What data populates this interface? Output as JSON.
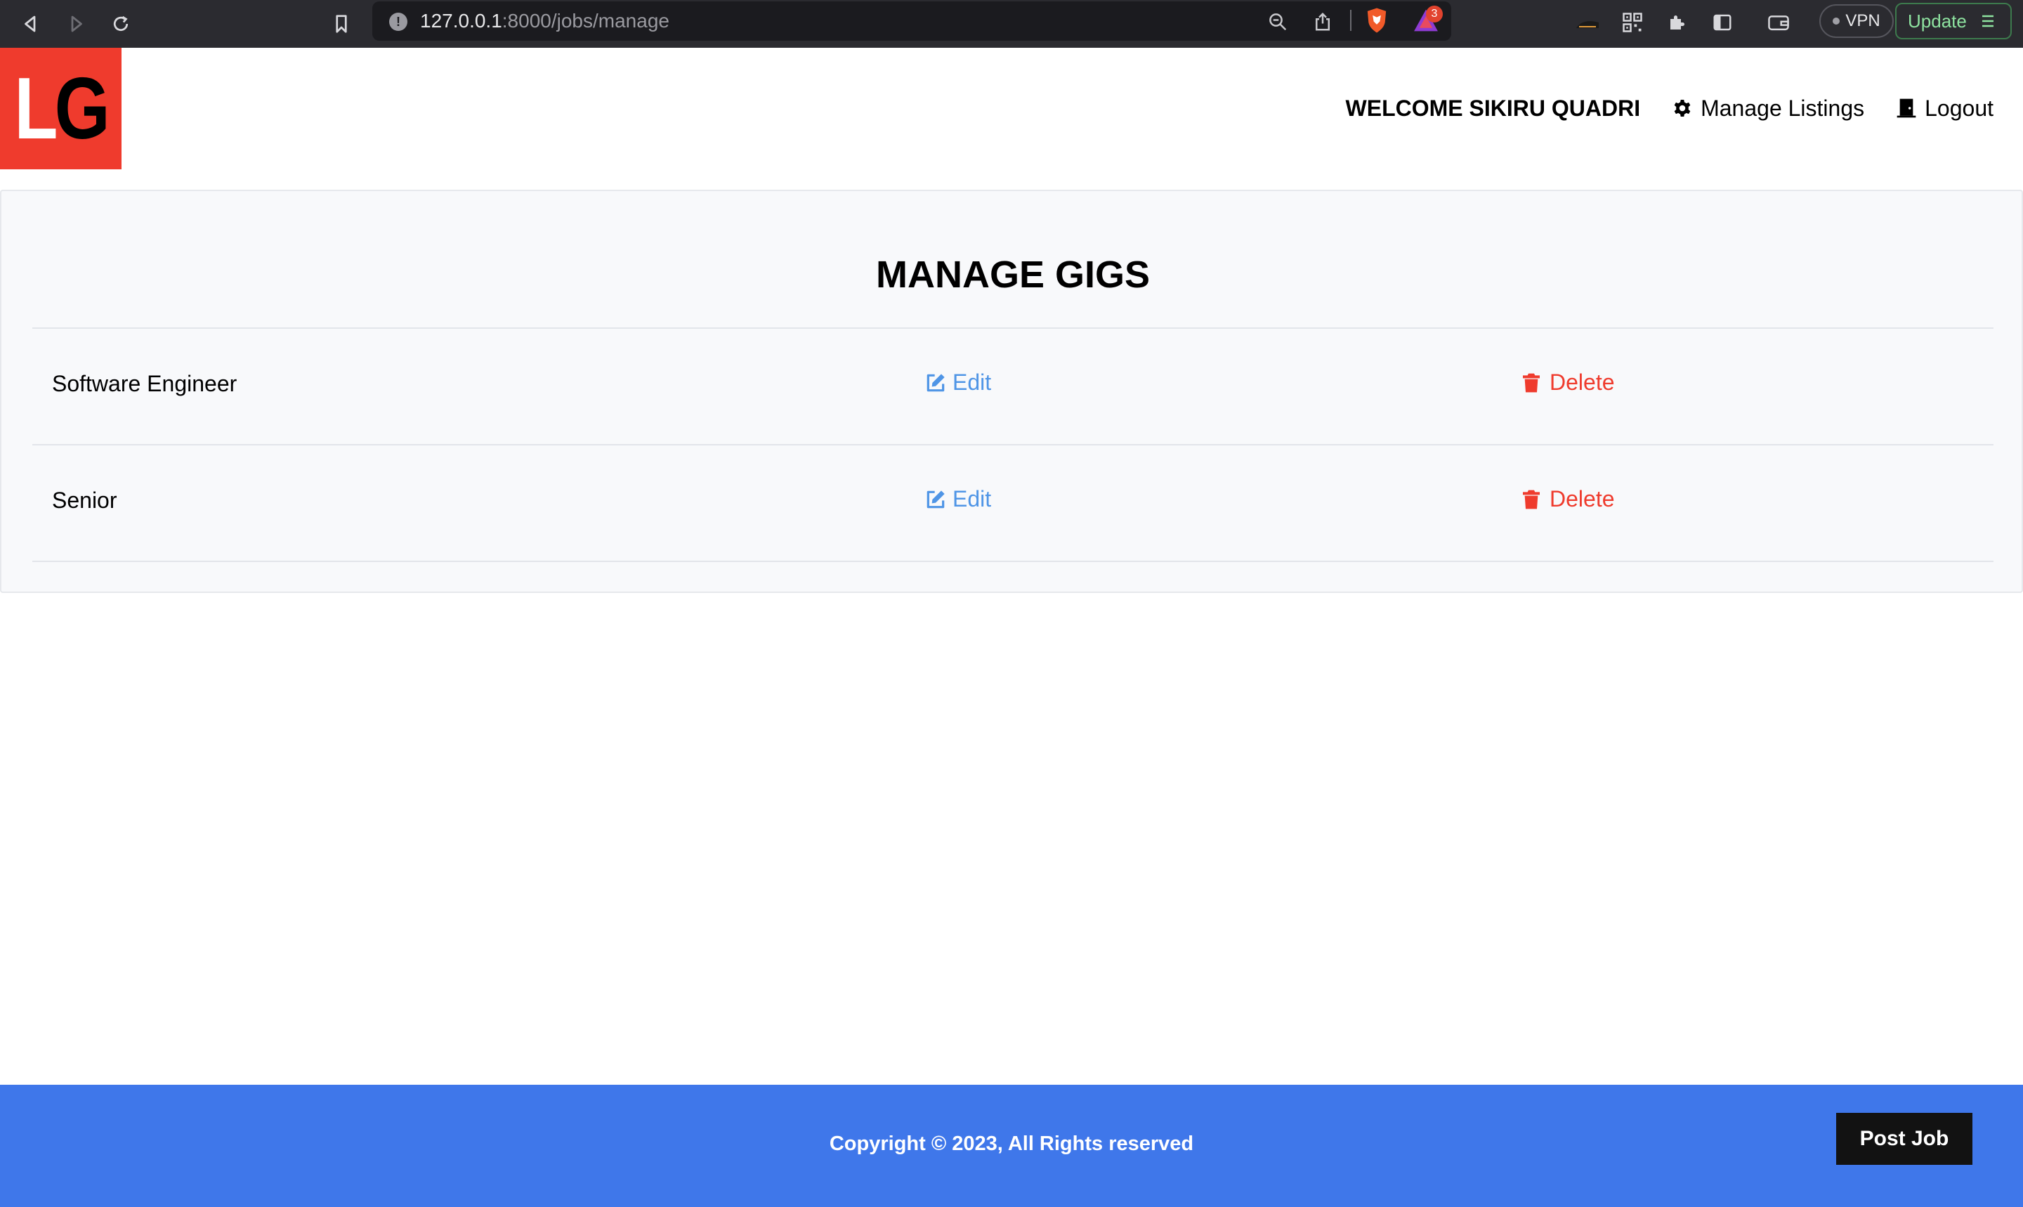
{
  "browser": {
    "url_host": "127.0.0.1",
    "url_rest": ":8000/jobs/manage",
    "rewards_badge": "3",
    "vpn_label": "VPN",
    "update_label": "Update"
  },
  "header": {
    "logo_letter_1": "L",
    "logo_letter_2": "G",
    "welcome": "WELCOME SIKIRU QUADRI",
    "manage_listings": "Manage Listings",
    "logout": "Logout"
  },
  "manage": {
    "title": "MANAGE GIGS",
    "edit_label": "Edit",
    "delete_label": "Delete",
    "gigs": [
      {
        "title": "Software Engineer"
      },
      {
        "title": "Senior"
      }
    ]
  },
  "footer": {
    "copyright": "Copyright © 2023, All Rights reserved",
    "post_job": "Post Job"
  },
  "colors": {
    "brand_red": "#ef3b2d",
    "footer_blue": "#3f77ea",
    "edit_blue": "#4f95e6"
  }
}
